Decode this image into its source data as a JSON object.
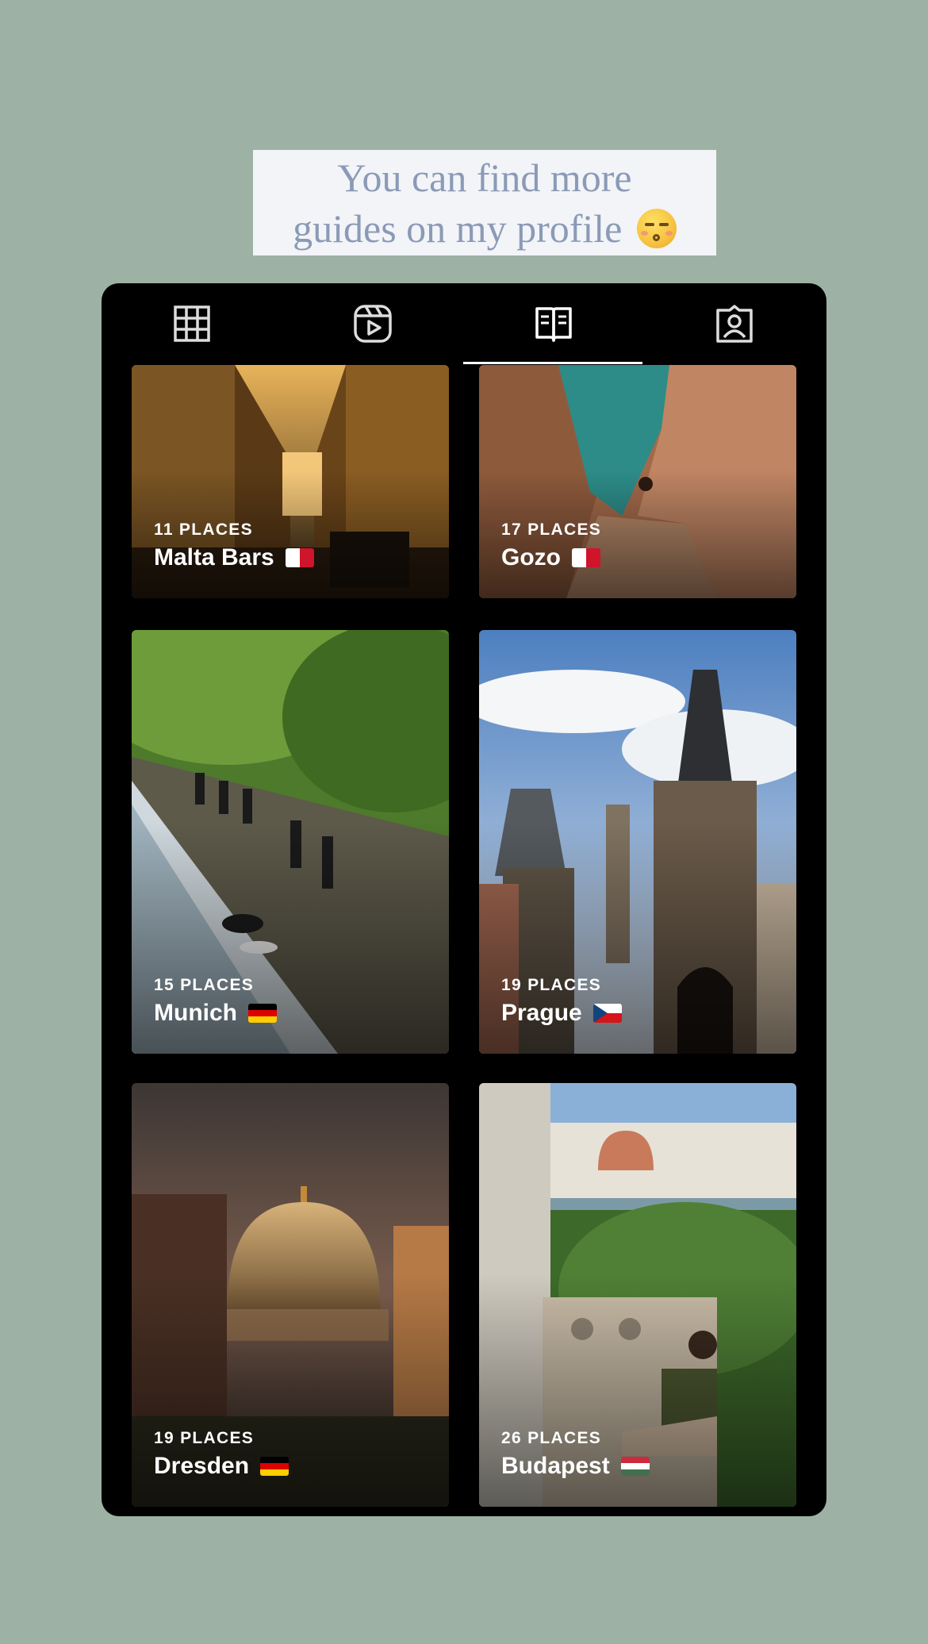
{
  "caption": {
    "line1": "You can find more",
    "line2": "guides on my profile",
    "emoji": "kissing-closed-eyes-emoji"
  },
  "tabs": [
    {
      "name": "grid",
      "icon": "grid-icon",
      "active": false
    },
    {
      "name": "reels",
      "icon": "reels-icon",
      "active": false
    },
    {
      "name": "guides",
      "icon": "guides-book-icon",
      "active": true
    },
    {
      "name": "tagged",
      "icon": "tagged-person-icon",
      "active": false
    }
  ],
  "guides": [
    {
      "count": "11 PLACES",
      "title": "Malta Bars",
      "flag": "malta-flag"
    },
    {
      "count": "17 PLACES",
      "title": "Gozo",
      "flag": "malta-flag"
    },
    {
      "count": "15 PLACES",
      "title": "Munich",
      "flag": "germany-flag"
    },
    {
      "count": "19 PLACES",
      "title": "Prague",
      "flag": "czech-flag"
    },
    {
      "count": "19 PLACES",
      "title": "Dresden",
      "flag": "germany-flag"
    },
    {
      "count": "26 PLACES",
      "title": "Budapest",
      "flag": "hungary-flag"
    }
  ],
  "colors": {
    "background": "#9db2a4",
    "panel": "#000000",
    "caption_bg": "#f2f4f8",
    "caption_text": "#8b9ab6"
  }
}
